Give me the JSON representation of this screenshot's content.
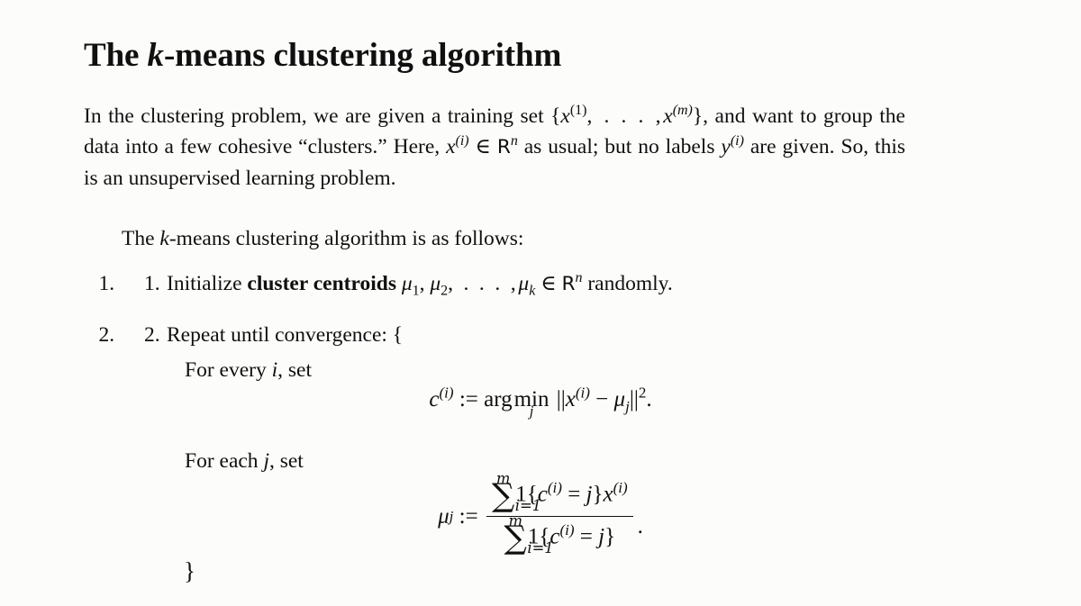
{
  "document": {
    "title_prefix": "The ",
    "title_math": "k",
    "title_suffix": "-means clustering algorithm",
    "background_color": "#fcfcfa",
    "text_color": "#101010"
  },
  "intro": {
    "s1": "In the clustering problem, we are given a training set ",
    "set_open": "{",
    "x1": "x",
    "x1_sup": "(1)",
    "comma_dots": ", . . . ,",
    "xm": "x",
    "xm_sup": "(m)",
    "set_close": "}",
    "s2": ", and want to group the data into a few cohesive “clusters.”  Here, ",
    "xi": "x",
    "xi_sup": "(i)",
    "in1": "∈",
    "R1": "R",
    "R1_sup": "n",
    "s3": " as usual; but no labels ",
    "yi": "y",
    "yi_sup": "(i)",
    "s4": " are given.  So, this is an unsupervised learning problem."
  },
  "follows": {
    "prefix": "The ",
    "k": "k",
    "suffix": "-means clustering algorithm is as follows:"
  },
  "steps": [
    {
      "number": "1.",
      "text_a": "Initialize ",
      "bold": "cluster centroids",
      "mu": "μ",
      "sub1": "1",
      "sep1": ", ",
      "sub2": "2",
      "dots": ", . . . ,",
      "subk": "k",
      "in": "∈",
      "R": "R",
      "R_sup": "n",
      "text_b": " randomly."
    },
    {
      "number": "2.",
      "text_a": "Repeat until convergence: {"
    }
  ],
  "sublines": {
    "for_every_i": "For every ",
    "i_var": "i",
    "for_every_i_tail": ", set",
    "for_each_j": "For each ",
    "j_var": "j",
    "for_each_j_tail": ", set"
  },
  "closing_brace": "}",
  "equations": {
    "eq1": {
      "lhs": "c",
      "lhs_sup": "(i)",
      "assign": ":=",
      "arg": "arg",
      "min": "min",
      "min_under": "j",
      "norm_open": "||",
      "x": "x",
      "x_sup": "(i)",
      "minus": "−",
      "mu": "μ",
      "mu_sub": "j",
      "norm_close": "||",
      "power": "2",
      "period": "."
    },
    "eq2": {
      "lhs_mu": "μ",
      "lhs_sub": "j",
      "assign": ":=",
      "sum": "∑",
      "sum_top": "m",
      "sum_bottom": "i=1",
      "indicator": "1{",
      "c": "c",
      "c_sup": "(i)",
      "equals": "=",
      "j": "j",
      "indicator_close": "}",
      "x": "x",
      "x_sup": "(i)",
      "period": "."
    }
  }
}
